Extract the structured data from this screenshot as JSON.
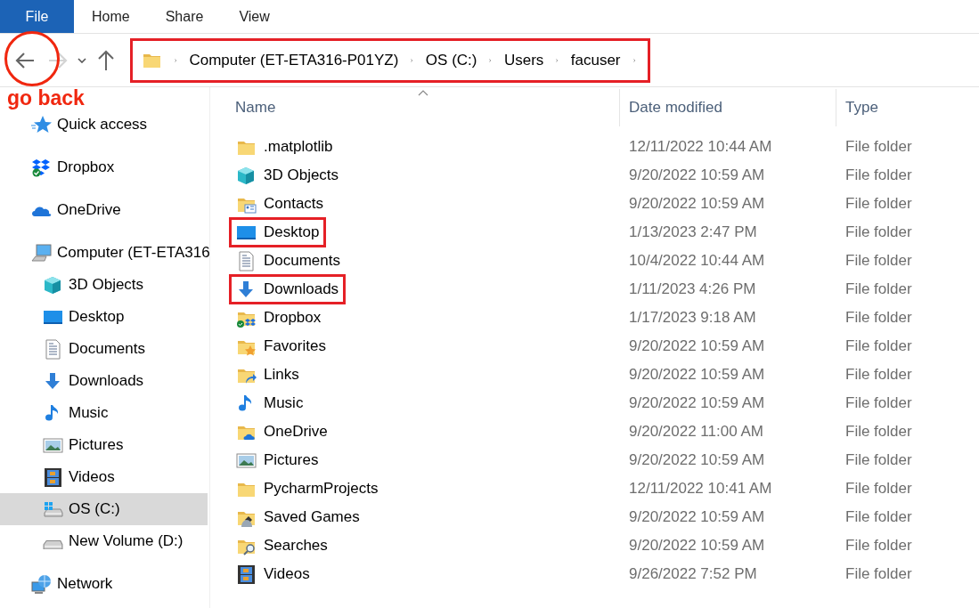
{
  "ribbon_tabs": [
    {
      "label": "File",
      "selected": true
    },
    {
      "label": "Home",
      "selected": false
    },
    {
      "label": "Share",
      "selected": false
    },
    {
      "label": "View",
      "selected": false
    }
  ],
  "navigation": {
    "back_circled": true,
    "forward_disabled": true,
    "annotation": "go back"
  },
  "address_bar": {
    "highlighted": true,
    "path": [
      "Computer (ET-ETA316-P01YZ)",
      "OS (C:)",
      "Users",
      "facuser"
    ]
  },
  "sidebar": {
    "items": [
      {
        "label": "Quick access",
        "kind": "star",
        "selected": false
      },
      {
        "label": "Dropbox",
        "kind": "dropbox",
        "selected": false
      },
      {
        "label": "OneDrive",
        "kind": "cloud",
        "selected": false
      },
      {
        "label": "Computer (ET-ETA316",
        "kind": "computer",
        "selected": false,
        "children": [
          {
            "label": "3D Objects",
            "kind": "cube",
            "selected": false
          },
          {
            "label": "Desktop",
            "kind": "desktop",
            "selected": false
          },
          {
            "label": "Documents",
            "kind": "documents",
            "selected": false
          },
          {
            "label": "Downloads",
            "kind": "downloads",
            "selected": false
          },
          {
            "label": "Music",
            "kind": "music",
            "selected": false
          },
          {
            "label": "Pictures",
            "kind": "pictures",
            "selected": false
          },
          {
            "label": "Videos",
            "kind": "videos",
            "selected": false
          },
          {
            "label": "OS (C:)",
            "kind": "drive-os",
            "selected": true
          },
          {
            "label": "New Volume (D:)",
            "kind": "drive",
            "selected": false
          }
        ]
      },
      {
        "label": "Network",
        "kind": "network",
        "selected": false
      }
    ]
  },
  "file_list": {
    "columns": [
      "Name",
      "Date modified",
      "Type"
    ],
    "rows": [
      {
        "name": ".matplotlib",
        "kind": "folder",
        "date_modified": "12/11/2022 10:44 AM",
        "type": "File folder",
        "highlighted": false
      },
      {
        "name": "3D Objects",
        "kind": "cube",
        "date_modified": "9/20/2022 10:59 AM",
        "type": "File folder",
        "highlighted": false
      },
      {
        "name": "Contacts",
        "kind": "folder-contacts",
        "date_modified": "9/20/2022 10:59 AM",
        "type": "File folder",
        "highlighted": false
      },
      {
        "name": "Desktop",
        "kind": "desktop",
        "date_modified": "1/13/2023 2:47 PM",
        "type": "File folder",
        "highlighted": true
      },
      {
        "name": "Documents",
        "kind": "documents",
        "date_modified": "10/4/2022 10:44 AM",
        "type": "File folder",
        "highlighted": false
      },
      {
        "name": "Downloads",
        "kind": "downloads",
        "date_modified": "1/11/2023 4:26 PM",
        "type": "File folder",
        "highlighted": true
      },
      {
        "name": "Dropbox",
        "kind": "folder-dropbox",
        "date_modified": "1/17/2023 9:18 AM",
        "type": "File folder",
        "highlighted": false
      },
      {
        "name": "Favorites",
        "kind": "folder-favorites",
        "date_modified": "9/20/2022 10:59 AM",
        "type": "File folder",
        "highlighted": false
      },
      {
        "name": "Links",
        "kind": "folder-links",
        "date_modified": "9/20/2022 10:59 AM",
        "type": "File folder",
        "highlighted": false
      },
      {
        "name": "Music",
        "kind": "music",
        "date_modified": "9/20/2022 10:59 AM",
        "type": "File folder",
        "highlighted": false
      },
      {
        "name": "OneDrive",
        "kind": "folder-onedrive",
        "date_modified": "9/20/2022 11:00 AM",
        "type": "File folder",
        "highlighted": false
      },
      {
        "name": "Pictures",
        "kind": "pictures",
        "date_modified": "9/20/2022 10:59 AM",
        "type": "File folder",
        "highlighted": false
      },
      {
        "name": "PycharmProjects",
        "kind": "folder",
        "date_modified": "12/11/2022 10:41 AM",
        "type": "File folder",
        "highlighted": false
      },
      {
        "name": "Saved Games",
        "kind": "folder-games",
        "date_modified": "9/20/2022 10:59 AM",
        "type": "File folder",
        "highlighted": false
      },
      {
        "name": "Searches",
        "kind": "folder-search",
        "date_modified": "9/20/2022 10:59 AM",
        "type": "File folder",
        "highlighted": false
      },
      {
        "name": "Videos",
        "kind": "videos",
        "date_modified": "9/26/2022 7:52 PM",
        "type": "File folder",
        "highlighted": false
      }
    ]
  }
}
